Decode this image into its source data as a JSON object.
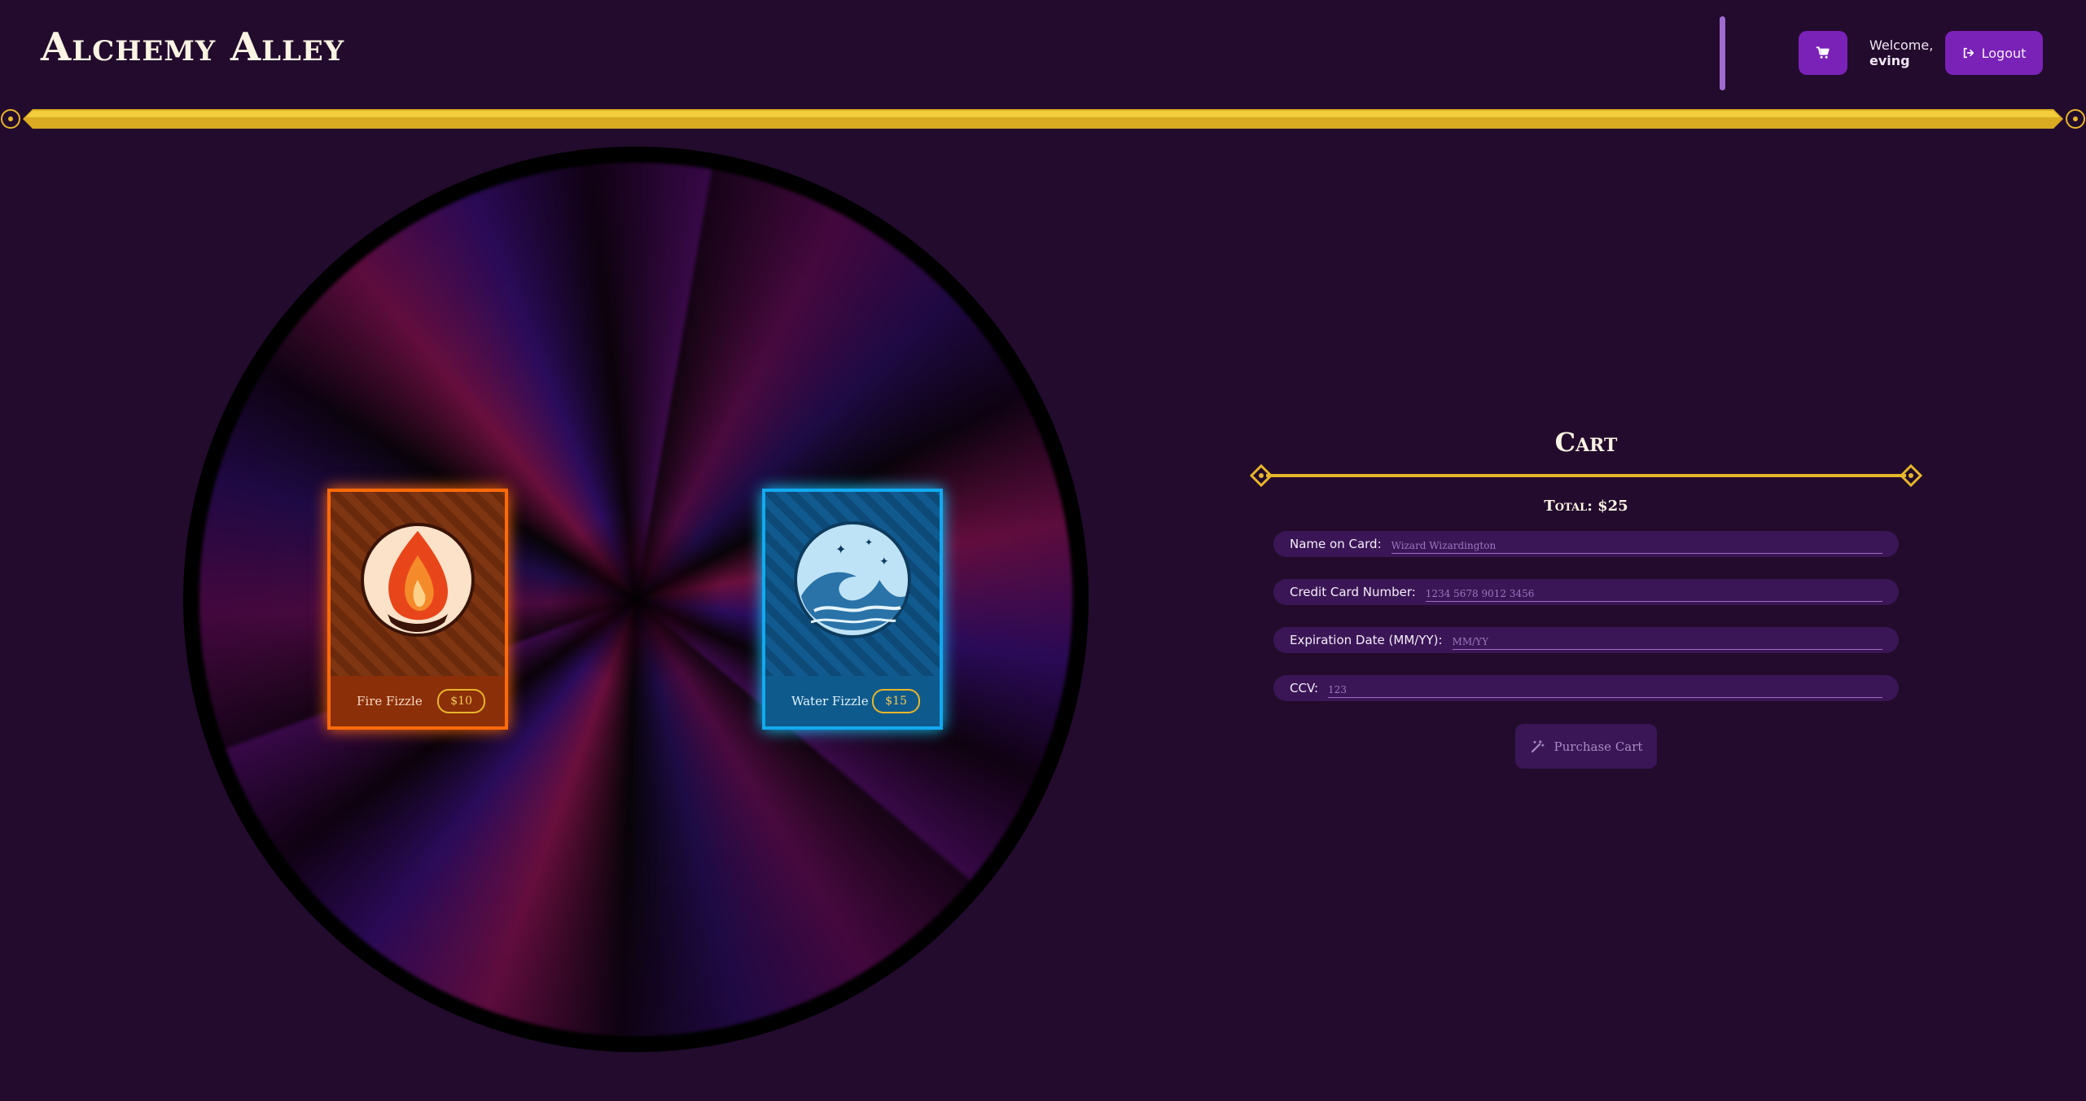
{
  "header": {
    "logo": "Alchemy Alley",
    "welcome_label": "Welcome,",
    "username": "eving",
    "logout_label": "Logout",
    "cart_icon": "cart-icon",
    "logout_icon": "logout-icon"
  },
  "colors": {
    "background": "#220b2c",
    "accent_purple": "#7a22b8",
    "gold": "#e8b62b",
    "fire": "#ff6a0b",
    "water": "#12a9f0"
  },
  "products": [
    {
      "name": "Fire Fizzle",
      "price": "$10",
      "icon": "fire-emblem-icon"
    },
    {
      "name": "Water Fizzle",
      "price": "$15",
      "icon": "wave-emblem-icon"
    }
  ],
  "cart": {
    "title": "Cart",
    "total": "Total: $25",
    "fields": {
      "name": {
        "label": "Name on Card:",
        "placeholder": "Wizard Wizardington"
      },
      "card_number": {
        "label": "Credit Card Number:",
        "placeholder": "1234 5678 9012 3456"
      },
      "expiration": {
        "label": "Expiration Date (MM/YY):",
        "placeholder": "MM/YY"
      },
      "ccv": {
        "label": "CCV:",
        "placeholder": "123"
      }
    },
    "purchase_label": "Purchase Cart",
    "purchase_icon": "magic-wand-icon"
  }
}
